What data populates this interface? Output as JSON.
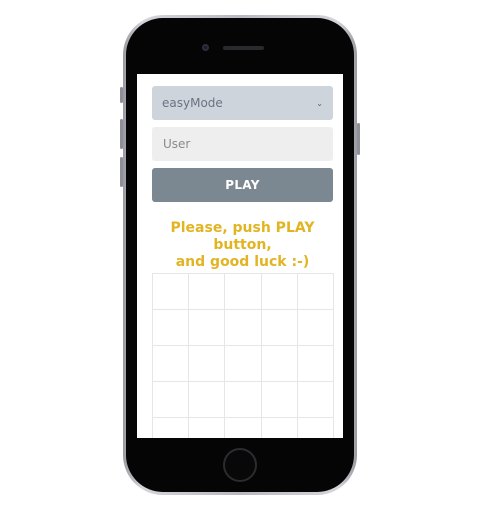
{
  "game_mode": {
    "selected": "easyMode"
  },
  "user_input": {
    "placeholder": "User",
    "value": ""
  },
  "play_button": {
    "label": "PLAY"
  },
  "status": {
    "line1": "Please, push PLAY button,",
    "line2": "and good luck :-)"
  },
  "board": {
    "columns": 5,
    "visible_rows": 5
  },
  "colors": {
    "message": "#e2b422",
    "play_button": "#7b8791",
    "select_bg": "#ced4dc"
  }
}
